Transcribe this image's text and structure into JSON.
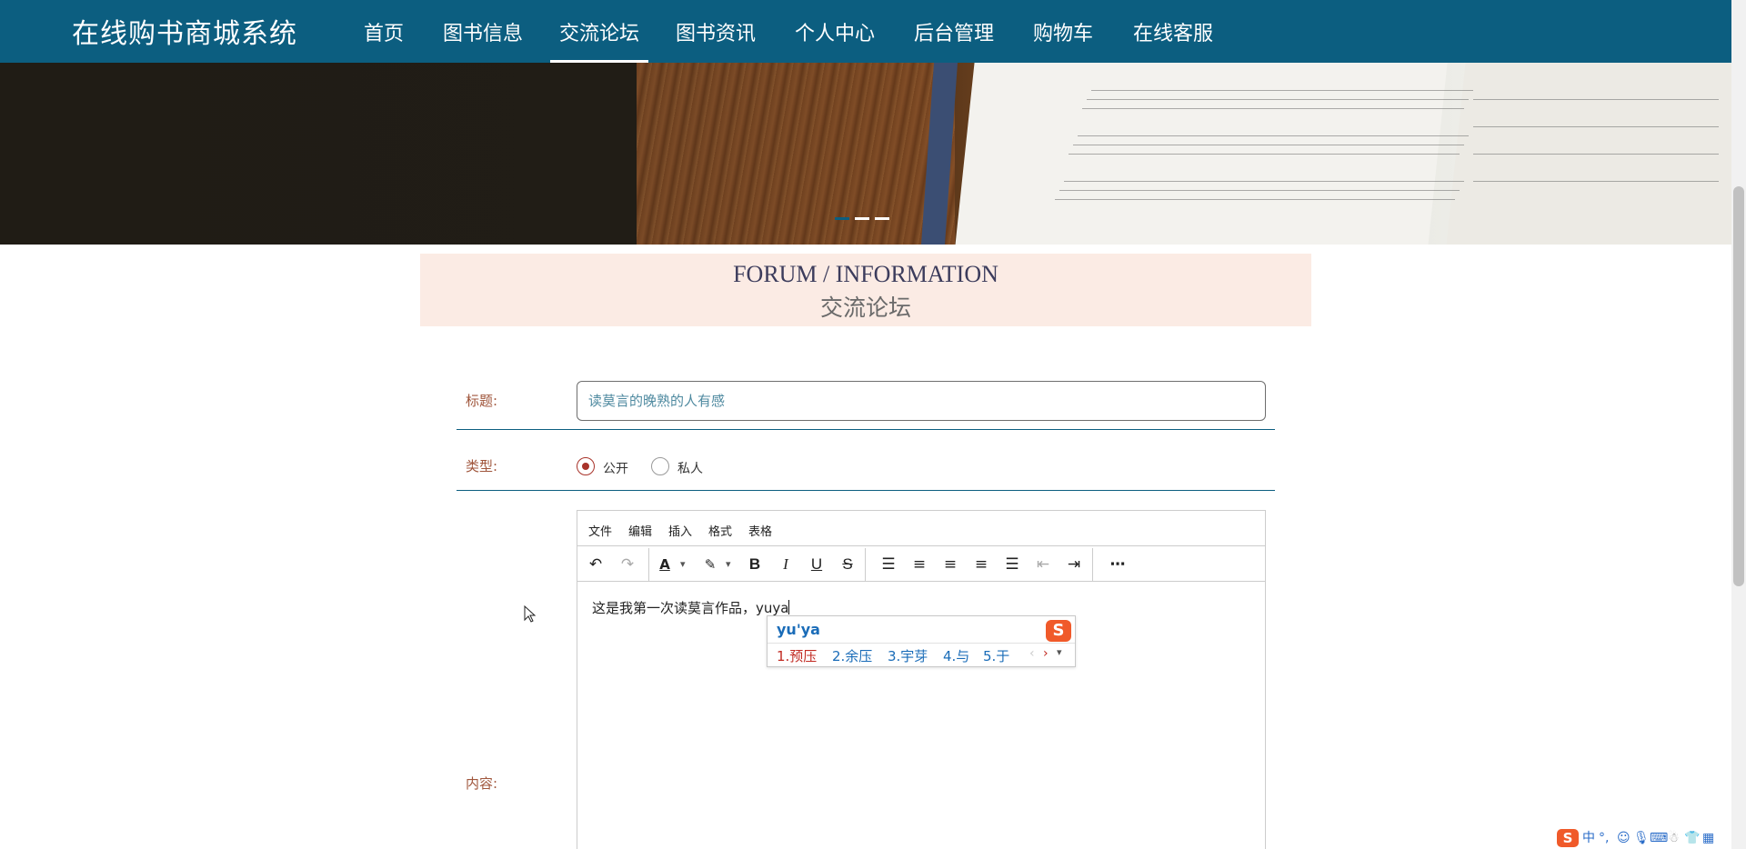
{
  "site": {
    "brand": "在线购书商城系统",
    "nav": [
      {
        "label": "首页",
        "active": false
      },
      {
        "label": "图书信息",
        "active": false
      },
      {
        "label": "交流论坛",
        "active": true
      },
      {
        "label": "图书资讯",
        "active": false
      },
      {
        "label": "个人中心",
        "active": false
      },
      {
        "label": "后台管理",
        "active": false
      },
      {
        "label": "购物车",
        "active": false
      },
      {
        "label": "在线客服",
        "active": false
      }
    ]
  },
  "banner": {
    "slides": 3,
    "active_slide": 1
  },
  "header": {
    "title_en": "FORUM / INFORMATION",
    "title_cn": "交流论坛"
  },
  "form": {
    "title_label": "标题:",
    "title_value": "读莫言的晚熟的人有感",
    "type_label": "类型:",
    "type_options": [
      {
        "label": "公开",
        "checked": true
      },
      {
        "label": "私人",
        "checked": false
      }
    ],
    "content_label": "内容:"
  },
  "editor": {
    "menu": [
      "文件",
      "编辑",
      "插入",
      "格式",
      "表格"
    ],
    "toolbar": [
      "undo-icon",
      "redo-icon",
      "font-color-icon",
      "highlight-color-icon",
      "bold-icon",
      "italic-icon",
      "underline-icon",
      "strikethrough-icon",
      "line-height-icon",
      "align-left-icon",
      "align-center-icon",
      "align-right-icon",
      "align-justify-icon",
      "outdent-icon",
      "indent-icon",
      "more-icon"
    ],
    "content": "这是我第一次读莫言作品，yuya"
  },
  "ime": {
    "composition": "yu'ya",
    "candidates": [
      "1.预压",
      "2.余压",
      "3.宇芽",
      "4.与",
      "5.于"
    ]
  },
  "tray": {
    "lang": "中",
    "punct": "°,"
  },
  "colors": {
    "nav_bg": "#0c5e80",
    "accent_red": "#a8332a",
    "label_brown": "#a0563c",
    "title_block_bg": "#fbebe4",
    "ime_blue": "#1a6cb8",
    "ime_red": "#c12a22"
  }
}
